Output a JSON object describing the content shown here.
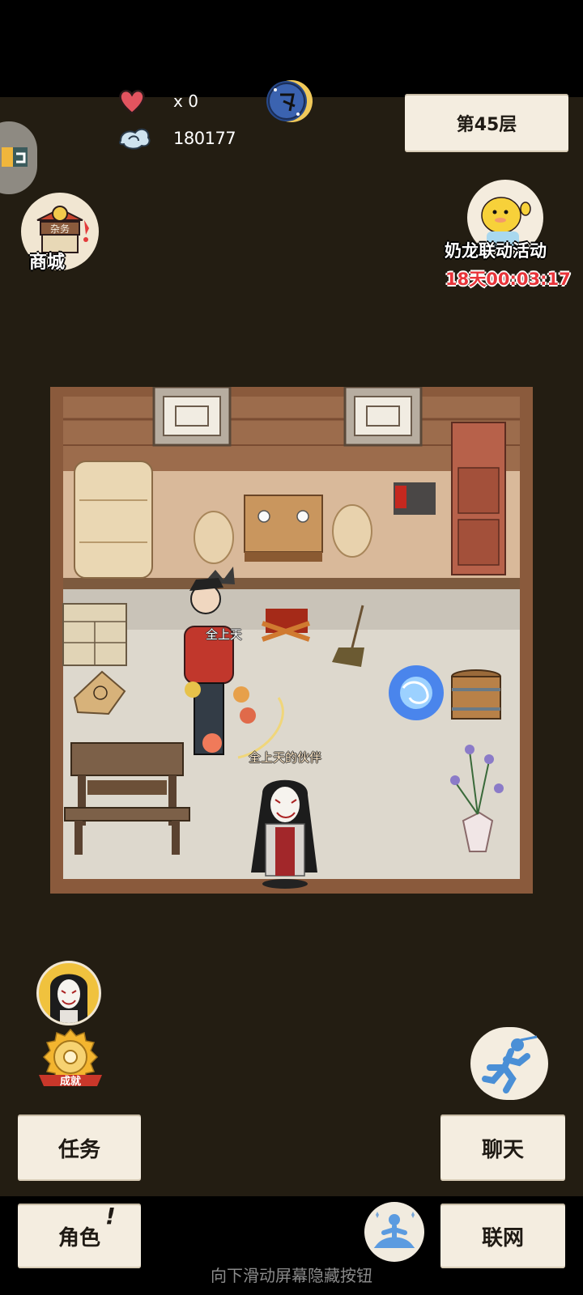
{
  "hud": {
    "lives": "x 0",
    "coins": "180177",
    "floor": "第45层"
  },
  "shop": {
    "label": "商城",
    "sign_text": "杂务"
  },
  "event": {
    "label": "奶龙联动活动",
    "timer": "18天00:03:17"
  },
  "room": {
    "player_name": "全上天",
    "partner_name": "全上天的伙伴"
  },
  "achievement": {
    "label": "成就"
  },
  "buttons": {
    "task": "任务",
    "chat": "聊天",
    "role": "角色",
    "network": "联网"
  },
  "hint": "向下滑动屏幕隐藏按钮",
  "colors": {
    "background": "#231d12",
    "paper": "#f4ede0",
    "timer_red": "#e8343a",
    "room_floor": "#ddd8cd",
    "room_platform": "#d9b99a",
    "room_wall": "#8a5a3c"
  },
  "icons": [
    "heart-icon",
    "coin-cloud-icon",
    "moon-badge-icon",
    "shop-icon",
    "event-mascot-icon",
    "avatar-icon",
    "achievement-icon",
    "run-icon",
    "meditate-icon",
    "portal-icon"
  ]
}
